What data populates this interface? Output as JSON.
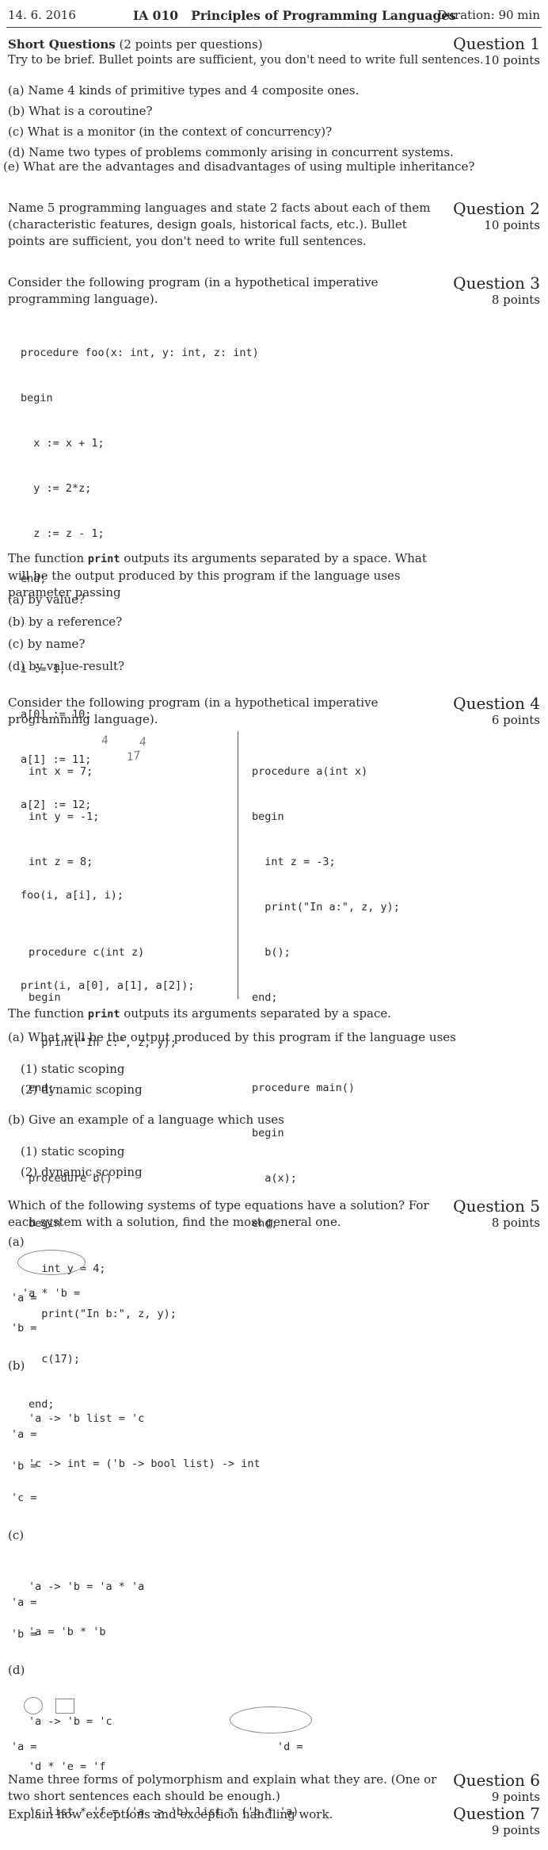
{
  "header": {
    "date": "14. 6. 2016",
    "course": "IA 010   Principles of Programming Languages",
    "duration": "Duration: 90 min"
  },
  "q1": {
    "title": "Question 1",
    "points": "10 points",
    "heading_bold": "Short Questions",
    "heading_rest": " (2 points per questions)",
    "instructions": "Try to be brief. Bullet points are sufficient, you don't need to write full sentences.",
    "items": [
      "(a) Name 4 kinds of primitive types and 4 composite ones.",
      "(b) What is a coroutine?",
      "(c) What is a monitor (in the context of concurrency)?",
      "(d) Name two types of problems commonly arising in concurrent systems.",
      "(e) What are the advantages and disadvantages of using multiple inheritance?"
    ]
  },
  "q2": {
    "title": "Question 2",
    "points": "10 points",
    "text": "Name 5 programming languages and state 2 facts about each of them (characteristic features, design goals, historical facts, etc.). Bullet points are sufficient, you don't need to write full sentences."
  },
  "q3": {
    "title": "Question 3",
    "points": "8 points",
    "intro": "Consider the following program (in a hypothetical imperative programming language).",
    "code": [
      "procedure foo(x: int, y: int, z: int)",
      "begin",
      "  x := x + 1;",
      "  y := 2*z;",
      "  z := z - 1;",
      "end;",
      "",
      "i := 1;",
      "a[0] := 10;",
      "a[1] := 11;",
      "a[2] := 12;",
      "",
      "foo(i, a[i], i);",
      "",
      "print(i, a[0], a[1], a[2]);"
    ],
    "after_pre": "The function ",
    "after_code": "print",
    "after_post": " outputs its arguments separated by a space.  What will be the output produced by this program if the language uses parameter passing",
    "items": [
      "(a) by value?",
      "(b) by a reference?",
      "(c) by name?",
      "(d) by value-result?"
    ]
  },
  "q4": {
    "title": "Question 4",
    "points": "6 points",
    "intro": "Consider the following program (in a hypothetical imperative programming language).",
    "code_left": [
      "int x = 7;",
      "int y = -1;",
      "int z = 8;",
      "",
      "procedure c(int z)",
      "begin",
      "  print(\"In c:\", z, y);",
      "end;",
      "",
      "procedure b()",
      "begin",
      "  int y = 4;",
      "  print(\"In b:\", z, y);",
      "  c(17);",
      "end;"
    ],
    "code_right": [
      "procedure a(int x)",
      "begin",
      "  int z = -3;",
      "  print(\"In a:\", z, y);",
      "  b();",
      "end;",
      "",
      "procedure main()",
      "begin",
      "  a(x);",
      "end;"
    ],
    "scribbles": [
      "4",
      "4",
      "17"
    ],
    "after_pre": "The function ",
    "after_code": "print",
    "after_post": " outputs its arguments separated by a space.",
    "part_a": "(a) What will be the output produced by this program if the language uses",
    "part_a_items": [
      "(1) static scoping",
      "(2) dynamic scoping"
    ],
    "part_b": "(b) Give an example of a language which uses",
    "part_b_items": [
      "(1) static scoping",
      "(2) dynamic scoping"
    ]
  },
  "q5": {
    "title": "Question 5",
    "points": "8 points",
    "intro": "Which of the following systems of type equations have a solution?  For each system with a solution, find the most general one.",
    "a": {
      "label": "(a)",
      "equations": [
        "'a * 'b ="
      ],
      "answers": [
        "'a =",
        "'b ="
      ]
    },
    "b": {
      "label": "(b)",
      "equations": [
        "'a -> 'b list = 'c",
        "'c -> int = ('b -> bool list) -> int"
      ],
      "answers": [
        "'a =",
        "'b =",
        "'c ="
      ]
    },
    "c": {
      "label": "(c)",
      "equations": [
        "'a -> 'b = 'a * 'a",
        "'a = 'b * 'b"
      ],
      "answers": [
        "'a =",
        "'b ="
      ]
    },
    "d": {
      "label": "(d)",
      "equations": [
        "'a -> 'b = 'c",
        "'d * 'e = 'f",
        "'c list * 'f = ('a -> 'b) list * ('b * 'a)"
      ],
      "answers": [
        "'a =",
        "'d ="
      ]
    }
  },
  "q6": {
    "title": "Question 6",
    "points": "9 points",
    "text": "Name three forms of polymorphism and explain what they are.  (One or two short sentences each should be enough.)"
  },
  "q7": {
    "title": "Question 7",
    "points": "9 points",
    "text": "Explain how exceptions and exception handling work."
  }
}
